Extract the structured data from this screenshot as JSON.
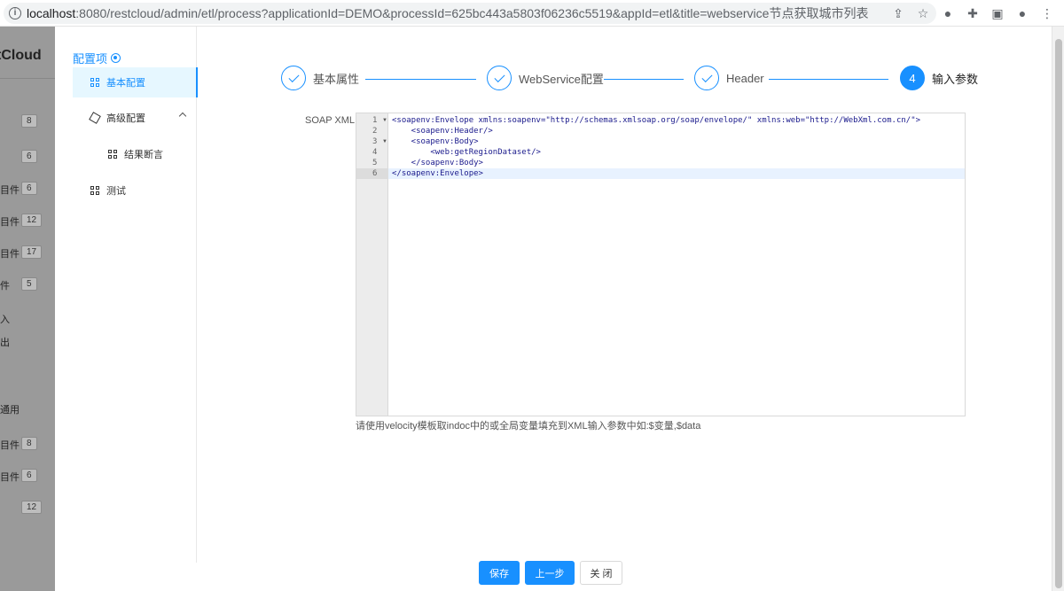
{
  "browser": {
    "url_host": "localhost",
    "url_rest": ":8080/restcloud/admin/etl/process?applicationId=DEMO&processId=625bc443a5803f06236c5519&appId=etl&title=webservice节点获取城市列表"
  },
  "background_app": {
    "brand": "tCloud",
    "rows": [
      {
        "text": "",
        "badge": "8"
      },
      {
        "text": "",
        "badge": "6"
      },
      {
        "text": "目件",
        "badge": "6"
      },
      {
        "text": "目件",
        "badge": "12"
      },
      {
        "text": "目件",
        "badge": "17"
      },
      {
        "text": "件",
        "badge": "5"
      },
      {
        "text": "入",
        "badge": ""
      },
      {
        "text": "出",
        "badge": ""
      },
      {
        "text": "通用",
        "badge": ""
      },
      {
        "text": "目件",
        "badge": "8"
      },
      {
        "text": "目件",
        "badge": "6"
      },
      {
        "text": "",
        "badge": "12"
      }
    ]
  },
  "sidebar": {
    "title": "配置项",
    "items": [
      {
        "label": "基本配置"
      },
      {
        "label": "高级配置"
      },
      {
        "label": "结果断言"
      },
      {
        "label": "测试"
      }
    ]
  },
  "steps": [
    {
      "label": "基本属性",
      "status": "done"
    },
    {
      "label": "WebService配置",
      "status": "done"
    },
    {
      "label": "Header",
      "status": "done"
    },
    {
      "label": "输入参数",
      "status": "current",
      "number": "4"
    }
  ],
  "form": {
    "soap_label": "SOAP XML:",
    "line_numbers": [
      "1",
      "2",
      "3",
      "4",
      "5",
      "6"
    ],
    "code_lines": [
      "<soapenv:Envelope xmlns:soapenv=\"http://schemas.xmlsoap.org/soap/envelope/\" xmlns:web=\"http://WebXml.com.cn/\">",
      "    <soapenv:Header/>",
      "    <soapenv:Body>",
      "        <web:getRegionDataset/>",
      "    </soapenv:Body>",
      "</soapenv:Envelope>"
    ],
    "hint": "请使用velocity模板取indoc中的或全局变量填充到XML输入参数中如:$变量,$data"
  },
  "buttons": {
    "save": "保存",
    "prev": "上一步",
    "close": "关 闭"
  },
  "colors": {
    "accent": "#1890ff"
  }
}
